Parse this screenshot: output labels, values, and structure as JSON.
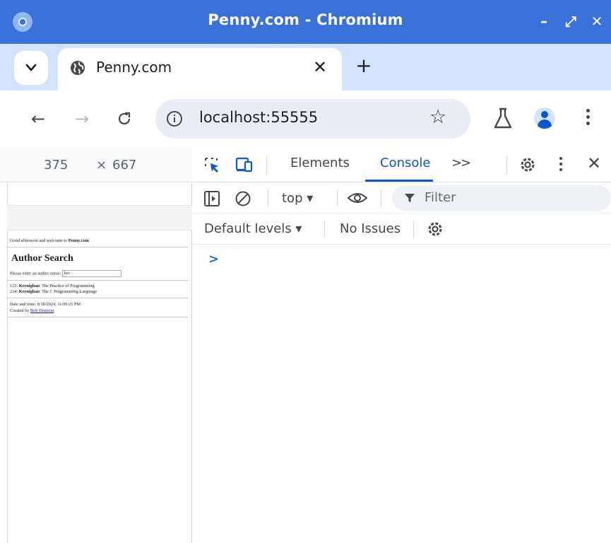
{
  "window": {
    "title": "Penny.com - Chromium",
    "minimize_label": "–",
    "maximize_label": "⤢",
    "close_label": "✕"
  },
  "tabs": {
    "search_icon": "chevron-down-icon",
    "active_tab_title": "Penny.com",
    "active_tab_favicon": "globe-icon",
    "close_label": "✕",
    "new_tab_label": "+"
  },
  "toolbar": {
    "back_label": "←",
    "forward_label": "→",
    "reload_label": "C",
    "url": "localhost:55555",
    "star_label": "☆",
    "menu_icon": "kebab-icon"
  },
  "viewport": {
    "width": "375",
    "times": "×",
    "height": "667"
  },
  "page": {
    "greeting_prefix": "Good afternoon and welcome to ",
    "greeting_site": "Penny.com",
    "heading": "Author Search",
    "prompt_label": "Please enter an author name: ",
    "prompt_value": "ker",
    "results": [
      {
        "id": "123:",
        "author": "Kernighan",
        "title": ": The Practice of Programming"
      },
      {
        "id": "234:",
        "author": "Kernighan",
        "title": ": The C Programming Language"
      }
    ],
    "datetime": "Date and time: 8/18/2024, 11:09:21 PM",
    "created_prefix": "Created by ",
    "created_link": "Bob Denison"
  },
  "devtools": {
    "tab_elements": "Elements",
    "tab_console": "Console",
    "tab_more": ">>",
    "context": "top ▾",
    "filter_placeholder": "Filter",
    "levels": "Default levels ▾",
    "issues": "No Issues",
    "prompt": ">",
    "accent_color": "#0b57d0"
  }
}
